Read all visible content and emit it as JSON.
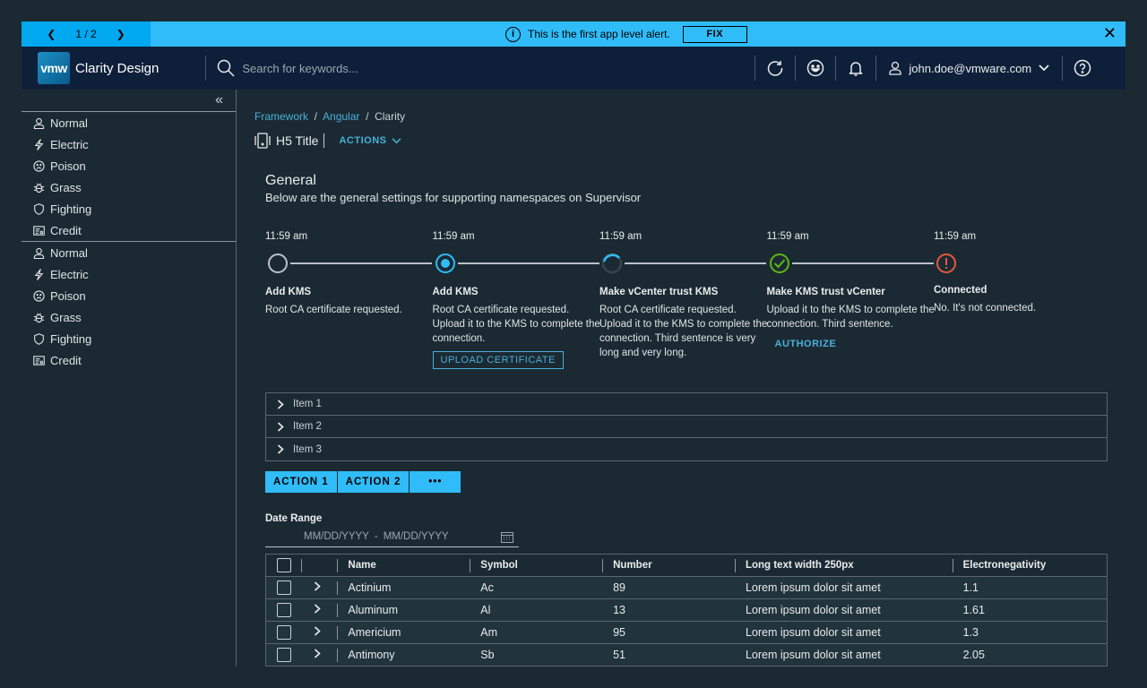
{
  "alert": {
    "pager": "1 / 2",
    "message": "This is the first app level alert.",
    "fix_label": "FIX"
  },
  "header": {
    "logo": "vmw",
    "brand": "Clarity Design",
    "search_placeholder": "Search for keywords...",
    "user": "john.doe@vmware.com"
  },
  "sidebar": {
    "groups": [
      [
        "Normal",
        "Electric",
        "Poison",
        "Grass",
        "Fighting",
        "Credit"
      ],
      [
        "Normal",
        "Electric",
        "Poison",
        "Grass",
        "Fighting",
        "Credit"
      ]
    ],
    "icons": [
      "user-icon",
      "bolt-icon",
      "sad-face-icon",
      "bug-icon",
      "shield-icon",
      "id-card-icon"
    ]
  },
  "breadcrumb": [
    "Framework",
    "Angular",
    "Clarity"
  ],
  "title": {
    "text": "H5 Title",
    "actions": "ACTIONS"
  },
  "general": {
    "title": "General",
    "desc": "Below are the general settings for supporting namespaces on Supervisor"
  },
  "timeline": [
    {
      "time": "11:59 am",
      "state": "not-started",
      "title": "Add KMS",
      "desc": "Root CA certificate requested."
    },
    {
      "time": "11:59 am",
      "state": "current",
      "title": "Add KMS",
      "desc": "Root CA certificate requested. Upload it to the KMS to complete the connection.",
      "button": "UPLOAD CERTIFICATE"
    },
    {
      "time": "11:59 am",
      "state": "processing",
      "title": "Make vCenter trust KMS",
      "desc": "Root CA certificate requested. Upload it to the KMS to complete the connection. Third sentence is very long and very long."
    },
    {
      "time": "11:59 am",
      "state": "success",
      "title": "Make KMS trust vCenter",
      "desc": "Upload it to the KMS to complete the connection. Third sentence.",
      "button": "AUTHORIZE"
    },
    {
      "time": "11:59 am",
      "state": "error",
      "title": "Connected",
      "desc": "No. It's not connected."
    }
  ],
  "accordion": [
    "Item 1",
    "Item 2",
    "Item 3"
  ],
  "buttons": [
    "ACTION 1",
    "ACTION 2",
    "•••"
  ],
  "date_range": {
    "label": "Date Range",
    "start_placeholder": "MM/DD/YYYY",
    "sep": "-",
    "end_placeholder": "MM/DD/YYYY"
  },
  "table": {
    "columns": [
      "Name",
      "Symbol",
      "Number",
      "Long text width 250px",
      "Electronegativity"
    ],
    "rows": [
      [
        "Actinium",
        "Ac",
        "89",
        "Lorem ipsum dolor sit amet",
        "1.1"
      ],
      [
        "Aluminum",
        "Al",
        "13",
        "Lorem ipsum dolor sit amet",
        "1.61"
      ],
      [
        "Americium",
        "Am",
        "95",
        "Lorem ipsum dolor sit amet",
        "1.3"
      ],
      [
        "Antimony",
        "Sb",
        "51",
        "Lorem ipsum dolor sit amet",
        "2.05"
      ]
    ]
  },
  "colors": {
    "accent": "#30bcf8",
    "link": "#49afd9",
    "header": "#0e2039",
    "success": "#5eb715",
    "error": "#e9573f"
  }
}
